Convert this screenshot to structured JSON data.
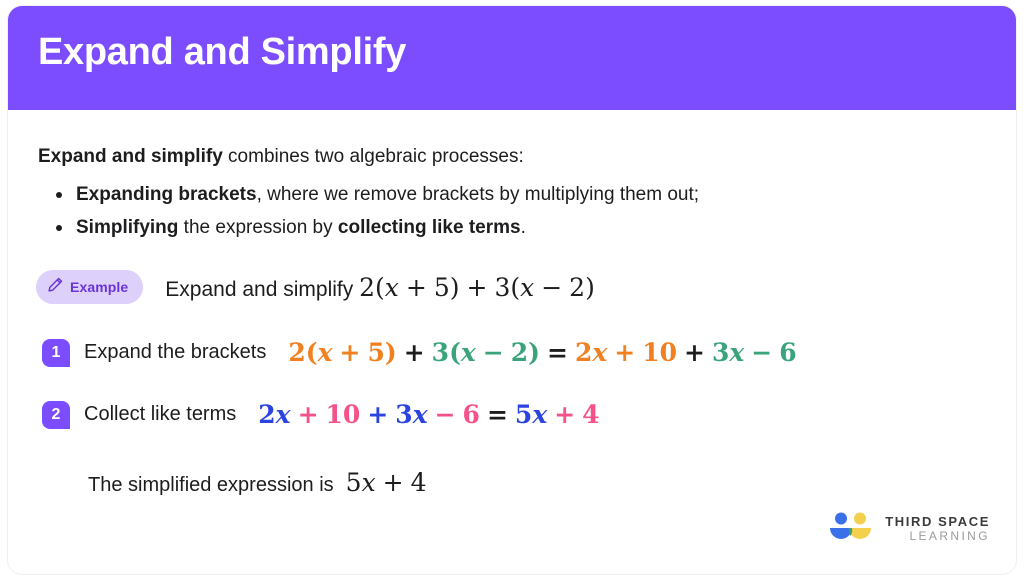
{
  "header": {
    "title": "Expand and Simplify",
    "background_color": "#7C4DFF"
  },
  "intro": {
    "bold_lead": "Expand and simplify",
    "rest": " combines two algebraic processes:"
  },
  "bullets": [
    {
      "bold_lead": "Expanding brackets",
      "rest": ", where we remove brackets by multiplying them out;"
    },
    {
      "bold_lead": "Simplifying",
      "mid": " the expression by ",
      "bold_tail": "collecting like terms",
      "tail": "."
    }
  ],
  "example": {
    "badge_label": "Example",
    "badge_icon": "pencil-icon",
    "badge_bg": "#DDD0FA",
    "badge_text_color": "#6B34D6",
    "prompt": "Expand and simplify",
    "expression": {
      "coef1": "2",
      "open1": "(",
      "var1": "x",
      "plus1": "+",
      "num1": "5",
      "close1": ")",
      "plus2": "+",
      "coef2": "3",
      "open2": "(",
      "var2": "x",
      "minus1": "−",
      "num2": "2",
      "close2": ")"
    }
  },
  "steps": [
    {
      "number": "1",
      "label": "Expand the brackets",
      "colors": {
        "term_a": "#F08020",
        "term_b": "#3BA37A",
        "neutral": "#1D1D1F"
      },
      "math": {
        "a_coef": "2",
        "a_open": "(",
        "a_var": "x",
        "a_plus": "+",
        "a_num": "5",
        "a_close": ")",
        "joiner": "+",
        "b_coef": "3",
        "b_open": "(",
        "b_var": "x",
        "b_minus": "−",
        "b_num": "2",
        "b_close": ")",
        "equals": "=",
        "r_a_coef": "2",
        "r_a_var": "x",
        "r_a_plus": "+",
        "r_a_num": "10",
        "r_joiner": "+",
        "r_b_coef": "3",
        "r_b_var": "x",
        "r_b_minus": "−",
        "r_b_num": "6"
      }
    },
    {
      "number": "2",
      "label": "Collect like terms",
      "colors": {
        "term_a": "#2B44E0",
        "term_b": "#F5528B",
        "neutral": "#1D1D1F"
      },
      "math": {
        "a_coef": "2",
        "a_var": "x",
        "a_plus": "+",
        "a_num": "10",
        "b_plus": "+",
        "b_coef": "3",
        "b_var": "x",
        "b_minus": "−",
        "b_num": "6",
        "equals": "=",
        "r_coef": "5",
        "r_var": "x",
        "r_plus": "+",
        "r_num": "4"
      }
    }
  ],
  "conclusion": {
    "text": "The simplified expression is",
    "expression": {
      "coef": "5",
      "var": "x",
      "plus": "+",
      "num": "4"
    }
  },
  "logo": {
    "line1": "THIRD SPACE",
    "line2": "LEARNING",
    "mark_blue": "#3B71E8",
    "mark_yellow": "#F5D04E",
    "mark_green": "#3AA06A"
  }
}
